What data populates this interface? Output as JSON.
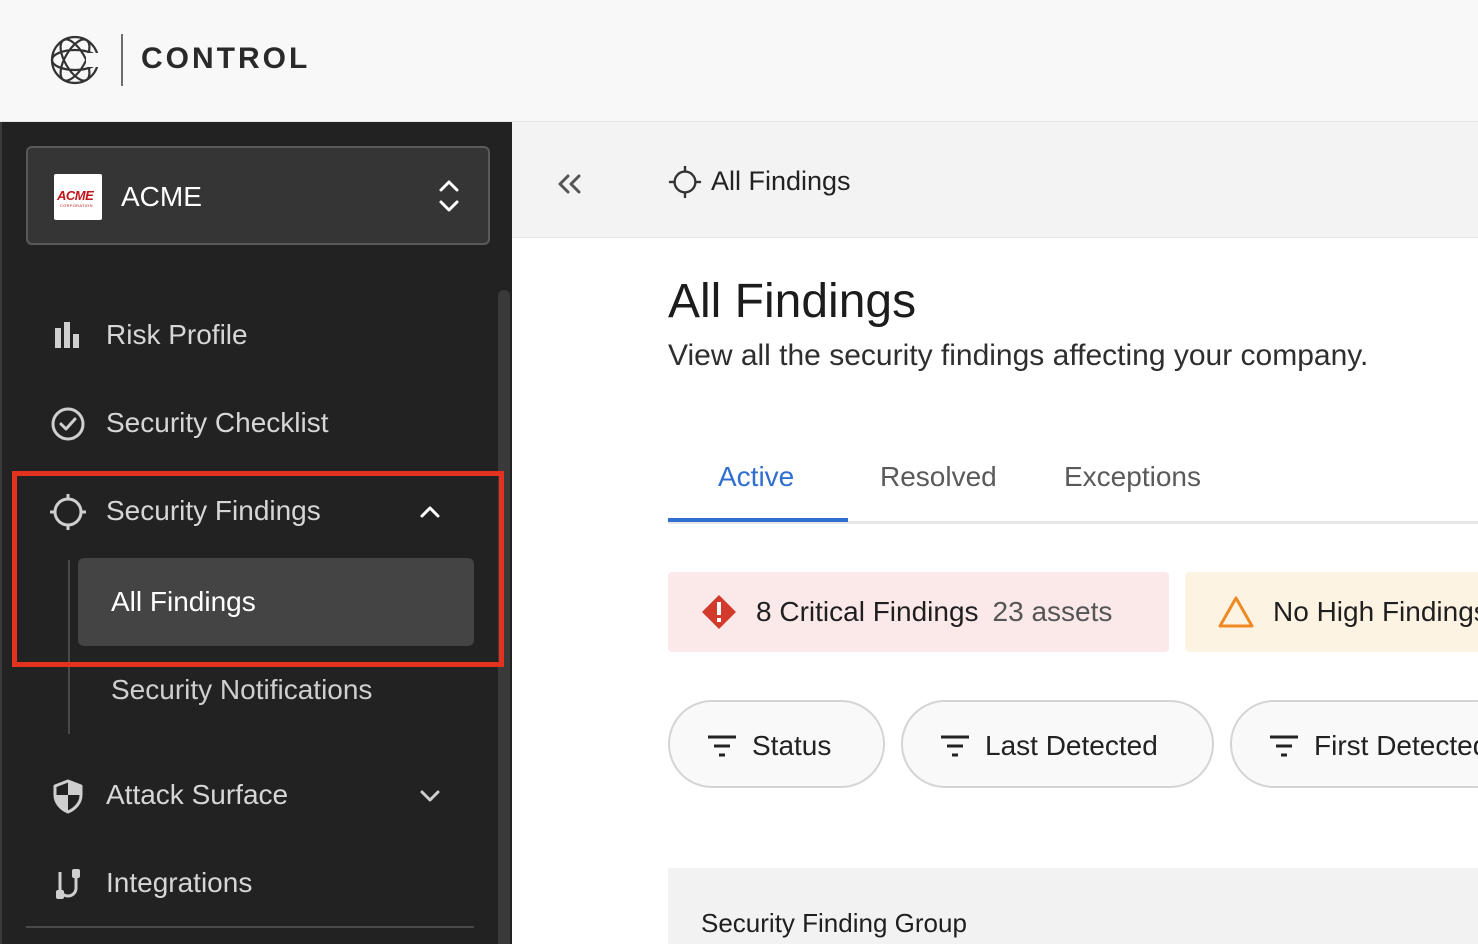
{
  "header": {
    "brand_name": "CONTROL",
    "logo_icon": "coalition-logo-icon"
  },
  "sidebar": {
    "org": {
      "name": "ACME",
      "logo_text": "ACME",
      "logo_subtext": "CORPORATION"
    },
    "items": [
      {
        "label": "Risk Profile",
        "icon": "bar-chart-icon"
      },
      {
        "label": "Security Checklist",
        "icon": "check-circle-icon"
      },
      {
        "label": "Security Findings",
        "icon": "crosshair-icon",
        "expanded": true,
        "children": [
          {
            "label": "All Findings",
            "active": true
          },
          {
            "label": "Security Notifications",
            "active": false
          }
        ]
      },
      {
        "label": "Attack Surface",
        "icon": "shield-icon",
        "expanded": false
      },
      {
        "label": "Integrations",
        "icon": "integrations-icon"
      }
    ]
  },
  "breadcrumb": {
    "label": "All Findings",
    "collapse_icon": "double-chevron-left-icon"
  },
  "page": {
    "title": "All Findings",
    "subtitle": "View all the security findings affecting your company."
  },
  "tabs": [
    {
      "label": "Active",
      "active": true
    },
    {
      "label": "Resolved",
      "active": false
    },
    {
      "label": "Exceptions",
      "active": false
    }
  ],
  "summary_cards": {
    "critical": {
      "title": "8 Critical Findings",
      "sub": "23 assets",
      "color": "#fbe9ea",
      "icon_color": "#d23a2c"
    },
    "high": {
      "title": "No High Findings",
      "color": "#fdf3e3",
      "icon_color": "#ef8a22"
    }
  },
  "filters": [
    {
      "label": "Status"
    },
    {
      "label": "Last Detected"
    },
    {
      "label": "First Detected"
    }
  ],
  "group_panel": {
    "title": "Security Finding Group"
  },
  "colors": {
    "accent": "#2f6fd0",
    "sidebar_bg": "#222222",
    "highlight": "#e3321f"
  }
}
